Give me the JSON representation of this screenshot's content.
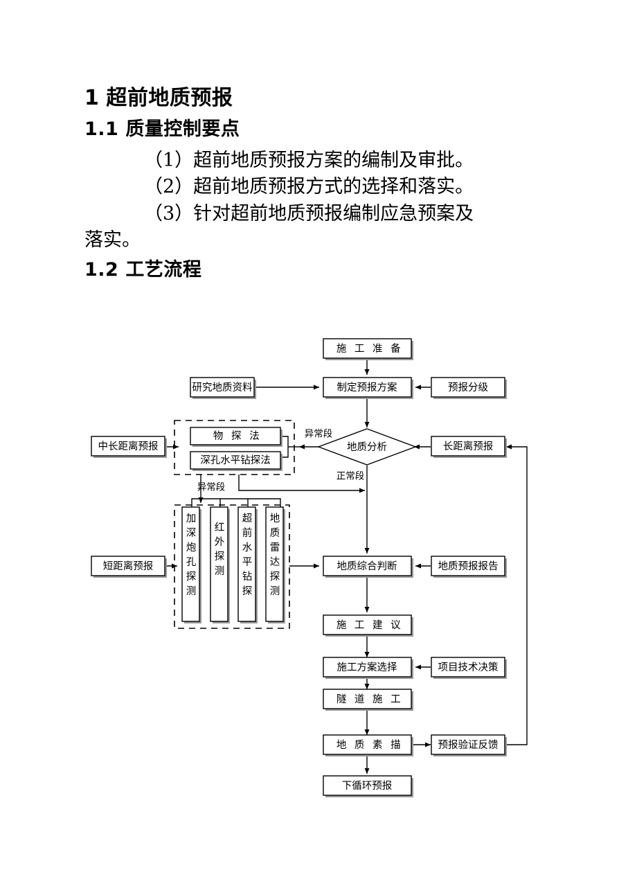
{
  "document": {
    "headings": {
      "h1_number": "1",
      "h1_title": "超前地质预报",
      "h2_number": "1.1",
      "h2_title": "质量控制要点",
      "h2b_number": "1.2",
      "h2b_title": "工艺流程"
    },
    "paragraphs": [
      "（1）超前地质预报方案的编制及审批。",
      "（2）超前地质预报方式的选择和落实。",
      "（3）针对超前地质预报编制应急预案及",
      "落实。"
    ]
  },
  "flowchart": {
    "type": "flowchart",
    "nodes": {
      "construction_prep": "施 工 准 备",
      "study_geo_data": "研究地质资料",
      "make_forecast_plan": "制定预报方案",
      "forecast_grading": "预报分级",
      "geo_analysis": "地质分析",
      "mid_long_distance_forecast": "中长距离预报",
      "long_distance_forecast": "长距离预报",
      "geophysical_method": "物 探 法",
      "deep_hole_horizontal_drilling_method": "深孔水平钻探法",
      "short_distance_forecast": "短距离预报",
      "deepened_blasthole_detection": "加深炮孔探测",
      "infrared_detection": "红外探测",
      "advance_horizontal_drilling": "超前水平钻探",
      "geological_radar_detection": "地质雷达探测",
      "comprehensive_geo_judgment": "地质综合判断",
      "geo_forecast_report": "地质预报报告",
      "construction_suggestion": "施 工 建 议",
      "construction_plan_selection": "施工方案选择",
      "project_technical_decision": "项目技术决策",
      "tunnel_construction": "隧 道 施 工",
      "geological_sketch": "地 质 素 描",
      "forecast_verification_feedback": "预报验证反馈",
      "next_cycle_forecast": "下循环预报"
    },
    "edge_labels": {
      "abnormal_section_upper": "异常段",
      "abnormal_section_lower": "异常段",
      "normal_section": "正常段"
    },
    "colors": {
      "line": "#000000",
      "box_fill": "#ffffff",
      "shadow": "#9a9a9a"
    }
  }
}
